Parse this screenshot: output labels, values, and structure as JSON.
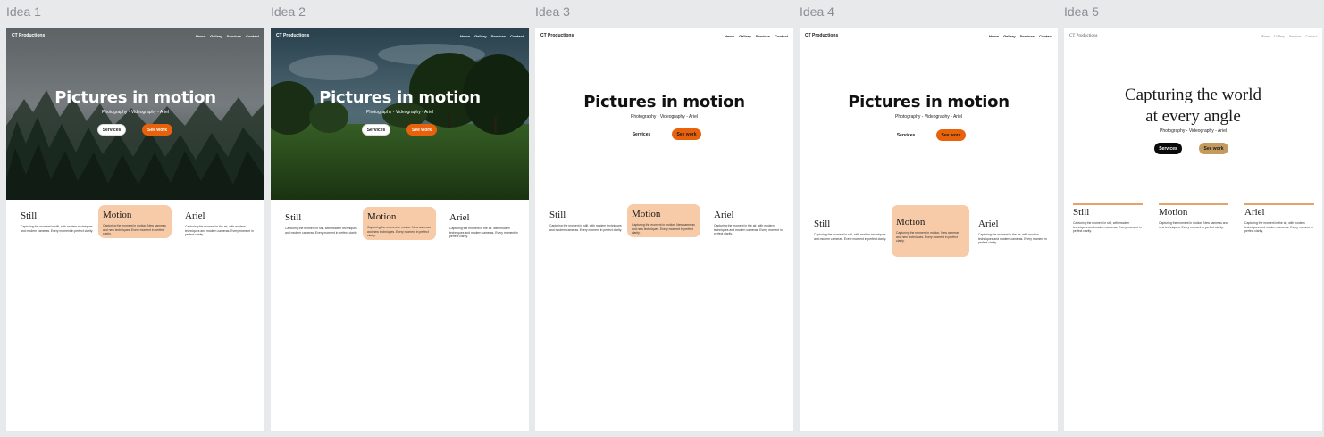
{
  "frames": [
    {
      "label": "Idea 1",
      "brand": "CT Productions",
      "nav": [
        "Home",
        "Gallery",
        "Services",
        "Contact"
      ],
      "title": "Pictures in motion",
      "subtitle": "Photography - Videography - Ariel",
      "btn_services": "Services",
      "btn_work": "See work",
      "columns": [
        {
          "title": "Still",
          "text": "Capturing the moment in still, with modern techniques and modern cameras. Every moment in perfect clarity."
        },
        {
          "title": "Motion",
          "text": "Capturing the moment in motion. New cameras and new techniques. Every moment in perfect clarity."
        },
        {
          "title": "Ariel",
          "text": "Capturing the moment in the air, with modern techniques and modern cameras. Every moment in perfect clarity."
        }
      ]
    },
    {
      "label": "Idea 2",
      "brand": "CT Productions",
      "nav": [
        "Home",
        "Gallery",
        "Services",
        "Contact"
      ],
      "title": "Pictures in motion",
      "subtitle": "Photography - Videography - Ariel",
      "btn_services": "Services",
      "btn_work": "See work",
      "columns": [
        {
          "title": "Still",
          "text": "Capturing the moment in still, with modern techniques and modern cameras. Every moment in perfect clarity."
        },
        {
          "title": "Motion",
          "text": "Capturing the moment in motion. New cameras and new techniques. Every moment in perfect clarity."
        },
        {
          "title": "Ariel",
          "text": "Capturing the moment in the air, with modern techniques and modern cameras. Every moment in perfect clarity."
        }
      ]
    },
    {
      "label": "Idea 3",
      "brand": "CT Productions",
      "nav": [
        "Home",
        "Gallery",
        "Services",
        "Contact"
      ],
      "title": "Pictures in motion",
      "subtitle": "Photography - Videography - Ariel",
      "btn_services": "Services",
      "btn_work": "See work",
      "columns": [
        {
          "title": "Still",
          "text": "Capturing the moment in still, with modern techniques and modern cameras. Every moment in perfect clarity."
        },
        {
          "title": "Motion",
          "text": "Capturing the moment in motion. New cameras and new techniques. Every moment in perfect clarity."
        },
        {
          "title": "Ariel",
          "text": "Capturing the moment in the air, with modern techniques and modern cameras. Every moment in perfect clarity."
        }
      ]
    },
    {
      "label": "Idea 4",
      "brand": "CT Productions",
      "nav": [
        "Home",
        "Gallery",
        "Services",
        "Contact"
      ],
      "title": "Pictures in motion",
      "subtitle": "Photography - Videography - Ariel",
      "btn_services": "Services",
      "btn_work": "See work",
      "columns": [
        {
          "title": "Still",
          "text": "Capturing the moment in still, with modern techniques and modern cameras. Every moment in perfect clarity."
        },
        {
          "title": "Motion",
          "text": "Capturing the moment in motion. New cameras and new techniques. Every moment in perfect clarity."
        },
        {
          "title": "Ariel",
          "text": "Capturing the moment in the air, with modern techniques and modern cameras. Every moment in perfect clarity."
        }
      ]
    },
    {
      "label": "Idea 5",
      "brand": "CT Productions",
      "nav": [
        "Home",
        "Gallery",
        "Services",
        "Contact"
      ],
      "title_line1": "Capturing the world",
      "title_line2": "at every angle",
      "subtitle": "Photography - Videography - Ariel",
      "btn_services": "Services",
      "btn_work": "See work",
      "columns": [
        {
          "title": "Still",
          "text": "Capturing the moment in still, with modern techniques and modern cameras. Every moment in perfect clarity."
        },
        {
          "title": "Motion",
          "text": "Capturing the moment in motion. New cameras and new techniques. Every moment in perfect clarity."
        },
        {
          "title": "Ariel",
          "text": "Capturing the moment in the air, with modern techniques and modern cameras. Every moment in perfect clarity."
        }
      ]
    }
  ],
  "colors": {
    "canvas": "#e8e9ea",
    "accent_orange": "#e8620c",
    "highlight_peach": "#f7cba8",
    "accent_tan": "#c49a5e",
    "label_gray": "#8a8f94"
  },
  "icons": {
    "hero_1": "forest-fog-photo",
    "hero_2": "green-meadow-trees-photo"
  }
}
